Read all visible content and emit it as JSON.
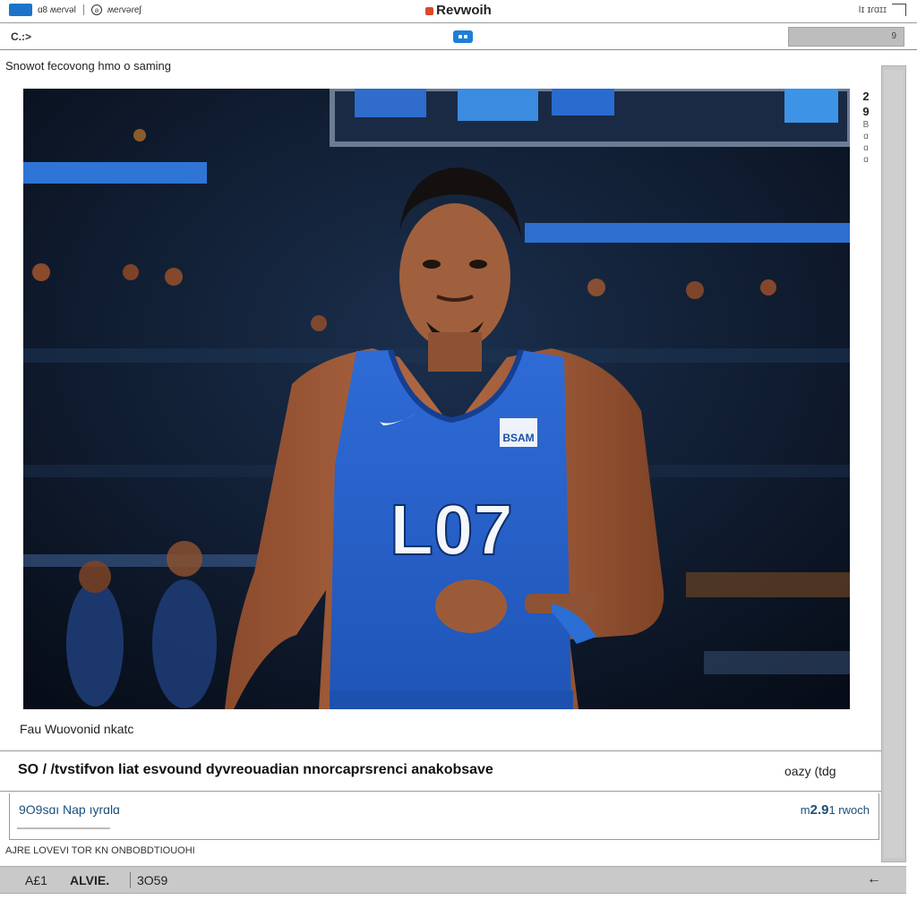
{
  "titlebar": {
    "left_label": "ɑ8 ʍeɾvəl",
    "circle_glyph": "ə",
    "left_text": "ʍeɾvəɾeʃ",
    "title": "Revwoih",
    "right_text": "Iɪ ɪɾɑɪɪ"
  },
  "toolbar": {
    "left_label": "C.:>",
    "right_value": "9"
  },
  "section": {
    "heading": "Snowot fecovong hmo o saming"
  },
  "side_marks": [
    "2",
    "9",
    "B",
    "ɑ",
    "ɑ",
    "ɑ"
  ],
  "photo": {
    "jersey_number": "L07",
    "jersey_tag": "BSAM"
  },
  "caption": "Fau Wuovonid nkatc",
  "headline": {
    "text": "SO / /tvstifvon liat esvound dyvreouadian nnorcaprsrenci anakobsave",
    "side": "oazy (tdg"
  },
  "info": {
    "left": "9O9sɑı Nap ıyrɑlɑ",
    "right_prefix": "m",
    "right_value": "2.9",
    "right_suffix": "1 rwoch"
  },
  "footnote": "AJRE LOVEVI TOR KN ONBOBDTIOUOHI",
  "statusbar": {
    "a": "A£1",
    "b": "ALVIE.",
    "c": "3O59",
    "arrow": "←"
  },
  "colors": {
    "accent_blue": "#1d7fd6",
    "jersey_blue": "#2a62c9",
    "status_gray": "#c9c9c9"
  },
  "icons": [
    "app-badge-icon",
    "circle-icon",
    "logo-icon",
    "corner-icon",
    "toggle-icon",
    "back-arrow-icon"
  ]
}
